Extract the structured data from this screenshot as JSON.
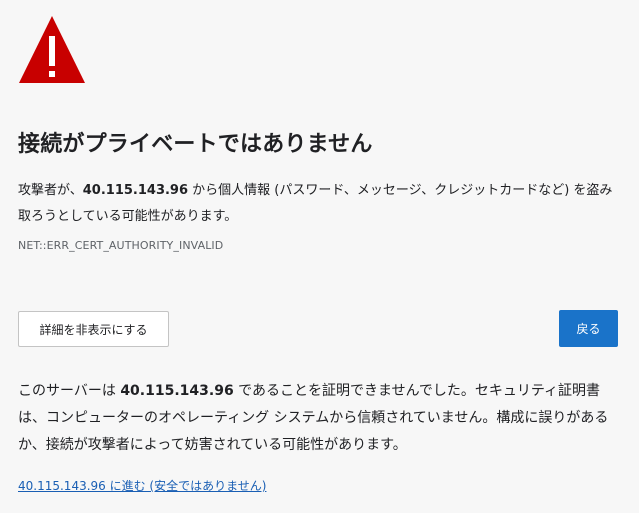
{
  "icon": {
    "name": "warning-triangle-icon",
    "color": "#c80000"
  },
  "title": "接続がプライベートではありません",
  "description": {
    "prefix": "攻撃者が、",
    "host": "40.115.143.96",
    "suffix": " から個人情報 (パスワード、メッセージ、クレジットカードなど) を盗み取ろうとしている可能性があります。"
  },
  "error_code": "NET::ERR_CERT_AUTHORITY_INVALID",
  "buttons": {
    "details_label": "詳細を非表示にする",
    "back_label": "戻る",
    "back_color": "#1a73c9"
  },
  "explanation": {
    "prefix": "このサーバーは ",
    "host": "40.115.143.96",
    "suffix": " であることを証明できませんでした。セキュリティ証明書は、コンピューターのオペレーティング システムから信頼されていません。構成に誤りがあるか、接続が攻撃者によって妨害されている可能性があります。"
  },
  "proceed_link": "40.115.143.96 に進む (安全ではありません)"
}
